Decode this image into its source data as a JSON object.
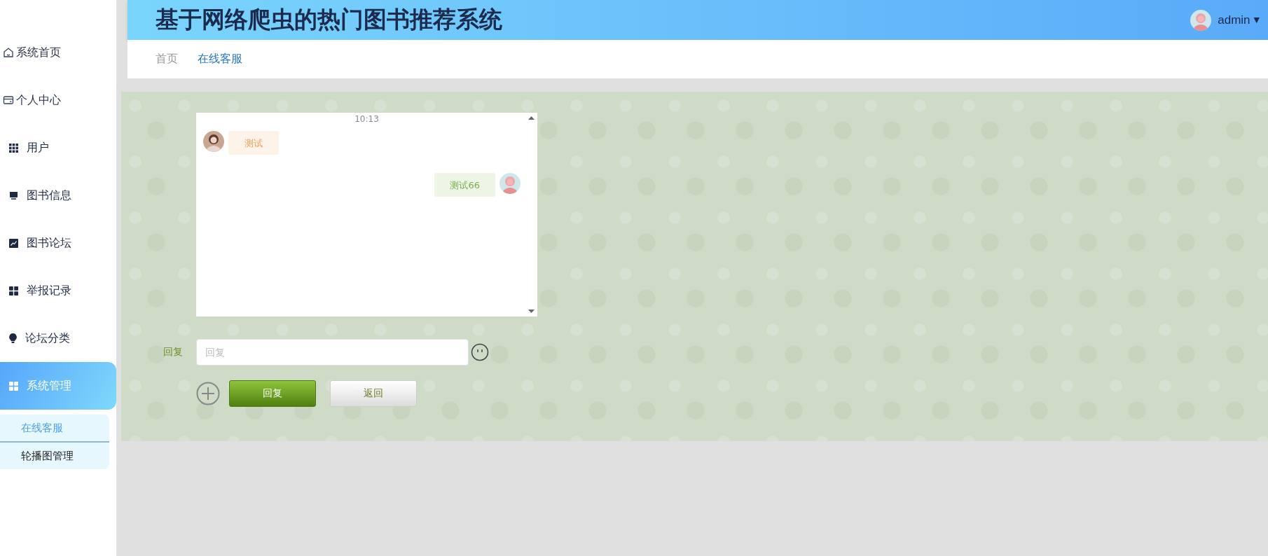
{
  "header": {
    "title": "基于网络爬虫的热门图书推荐系统",
    "user": {
      "name": "admin",
      "caret": "▼"
    }
  },
  "sidebar": {
    "items": [
      {
        "label": "系统首页",
        "selected": false
      },
      {
        "label": "个人中心",
        "selected": false
      },
      {
        "label": "用户",
        "selected": false
      },
      {
        "label": "图书信息",
        "selected": false
      },
      {
        "label": "图书论坛",
        "selected": false
      },
      {
        "label": "举报记录",
        "selected": false
      },
      {
        "label": "论坛分类",
        "selected": false
      },
      {
        "label": "系统管理",
        "selected": true,
        "expanded": true,
        "children": [
          {
            "label": "在线客服",
            "selected": true
          },
          {
            "label": "轮播图管理",
            "selected": false
          }
        ]
      }
    ]
  },
  "breadcrumb": [
    {
      "label": "首页",
      "selected": false
    },
    {
      "label": "在线客服",
      "selected": true
    }
  ],
  "chat": {
    "time": "10:13",
    "messages": [
      {
        "kind": "received",
        "text": "测试"
      },
      {
        "kind": "sent",
        "text": "测试66"
      }
    ]
  },
  "reply": {
    "label": "回复",
    "placeholder": "回复"
  },
  "buttons": [
    {
      "kind": "primary",
      "label": "回复"
    },
    {
      "kind": "secondary",
      "label": "返回"
    }
  ]
}
